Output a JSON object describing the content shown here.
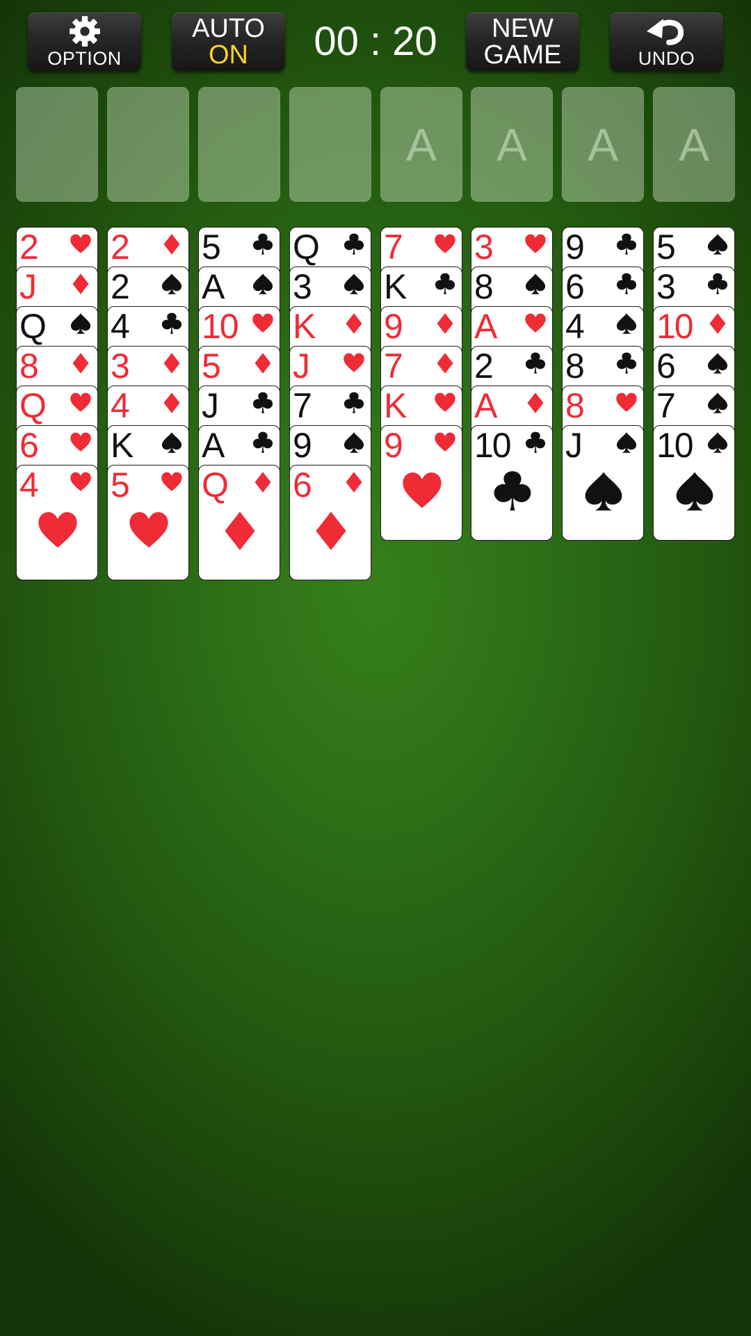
{
  "toolbar": {
    "option_label": "OPTION",
    "option_icon": "gear-icon",
    "auto_label": "AUTO",
    "auto_state": "ON",
    "timer": "00 : 20",
    "new_game_line1": "NEW",
    "new_game_line2": "GAME",
    "undo_label": "UNDO",
    "undo_icon": "undo-arrow-icon"
  },
  "free_cells": [
    "",
    "",
    "",
    ""
  ],
  "foundations": [
    "A",
    "A",
    "A",
    "A"
  ],
  "tableau": [
    [
      {
        "rank": "2",
        "suit": "hearts"
      },
      {
        "rank": "J",
        "suit": "diamonds"
      },
      {
        "rank": "Q",
        "suit": "spades"
      },
      {
        "rank": "8",
        "suit": "diamonds"
      },
      {
        "rank": "Q",
        "suit": "hearts"
      },
      {
        "rank": "6",
        "suit": "hearts"
      },
      {
        "rank": "4",
        "suit": "hearts"
      }
    ],
    [
      {
        "rank": "2",
        "suit": "diamonds"
      },
      {
        "rank": "2",
        "suit": "spades"
      },
      {
        "rank": "4",
        "suit": "clubs"
      },
      {
        "rank": "3",
        "suit": "diamonds"
      },
      {
        "rank": "4",
        "suit": "diamonds"
      },
      {
        "rank": "K",
        "suit": "spades"
      },
      {
        "rank": "5",
        "suit": "hearts"
      }
    ],
    [
      {
        "rank": "5",
        "suit": "clubs"
      },
      {
        "rank": "A",
        "suit": "spades"
      },
      {
        "rank": "10",
        "suit": "hearts"
      },
      {
        "rank": "5",
        "suit": "diamonds"
      },
      {
        "rank": "J",
        "suit": "clubs"
      },
      {
        "rank": "A",
        "suit": "clubs"
      },
      {
        "rank": "Q",
        "suit": "diamonds"
      }
    ],
    [
      {
        "rank": "Q",
        "suit": "clubs"
      },
      {
        "rank": "3",
        "suit": "spades"
      },
      {
        "rank": "K",
        "suit": "diamonds"
      },
      {
        "rank": "J",
        "suit": "hearts"
      },
      {
        "rank": "7",
        "suit": "clubs"
      },
      {
        "rank": "9",
        "suit": "spades"
      },
      {
        "rank": "6",
        "suit": "diamonds"
      }
    ],
    [
      {
        "rank": "7",
        "suit": "hearts"
      },
      {
        "rank": "K",
        "suit": "clubs"
      },
      {
        "rank": "9",
        "suit": "diamonds"
      },
      {
        "rank": "7",
        "suit": "diamonds"
      },
      {
        "rank": "K",
        "suit": "hearts"
      },
      {
        "rank": "9",
        "suit": "hearts"
      }
    ],
    [
      {
        "rank": "3",
        "suit": "hearts"
      },
      {
        "rank": "8",
        "suit": "spades"
      },
      {
        "rank": "A",
        "suit": "hearts"
      },
      {
        "rank": "2",
        "suit": "clubs"
      },
      {
        "rank": "A",
        "suit": "diamonds"
      },
      {
        "rank": "10",
        "suit": "clubs"
      }
    ],
    [
      {
        "rank": "9",
        "suit": "clubs"
      },
      {
        "rank": "6",
        "suit": "clubs"
      },
      {
        "rank": "4",
        "suit": "spades"
      },
      {
        "rank": "8",
        "suit": "clubs"
      },
      {
        "rank": "8",
        "suit": "hearts"
      },
      {
        "rank": "J",
        "suit": "spades"
      }
    ],
    [
      {
        "rank": "5",
        "suit": "spades"
      },
      {
        "rank": "3",
        "suit": "clubs"
      },
      {
        "rank": "10",
        "suit": "diamonds"
      },
      {
        "rank": "6",
        "suit": "spades"
      },
      {
        "rank": "7",
        "suit": "spades"
      },
      {
        "rank": "10",
        "suit": "spades"
      }
    ]
  ],
  "colors": {
    "felt": "#2c6c16",
    "red_suit": "#ef2b36",
    "black_suit": "#111111",
    "auto_on": "#ffd21f"
  }
}
